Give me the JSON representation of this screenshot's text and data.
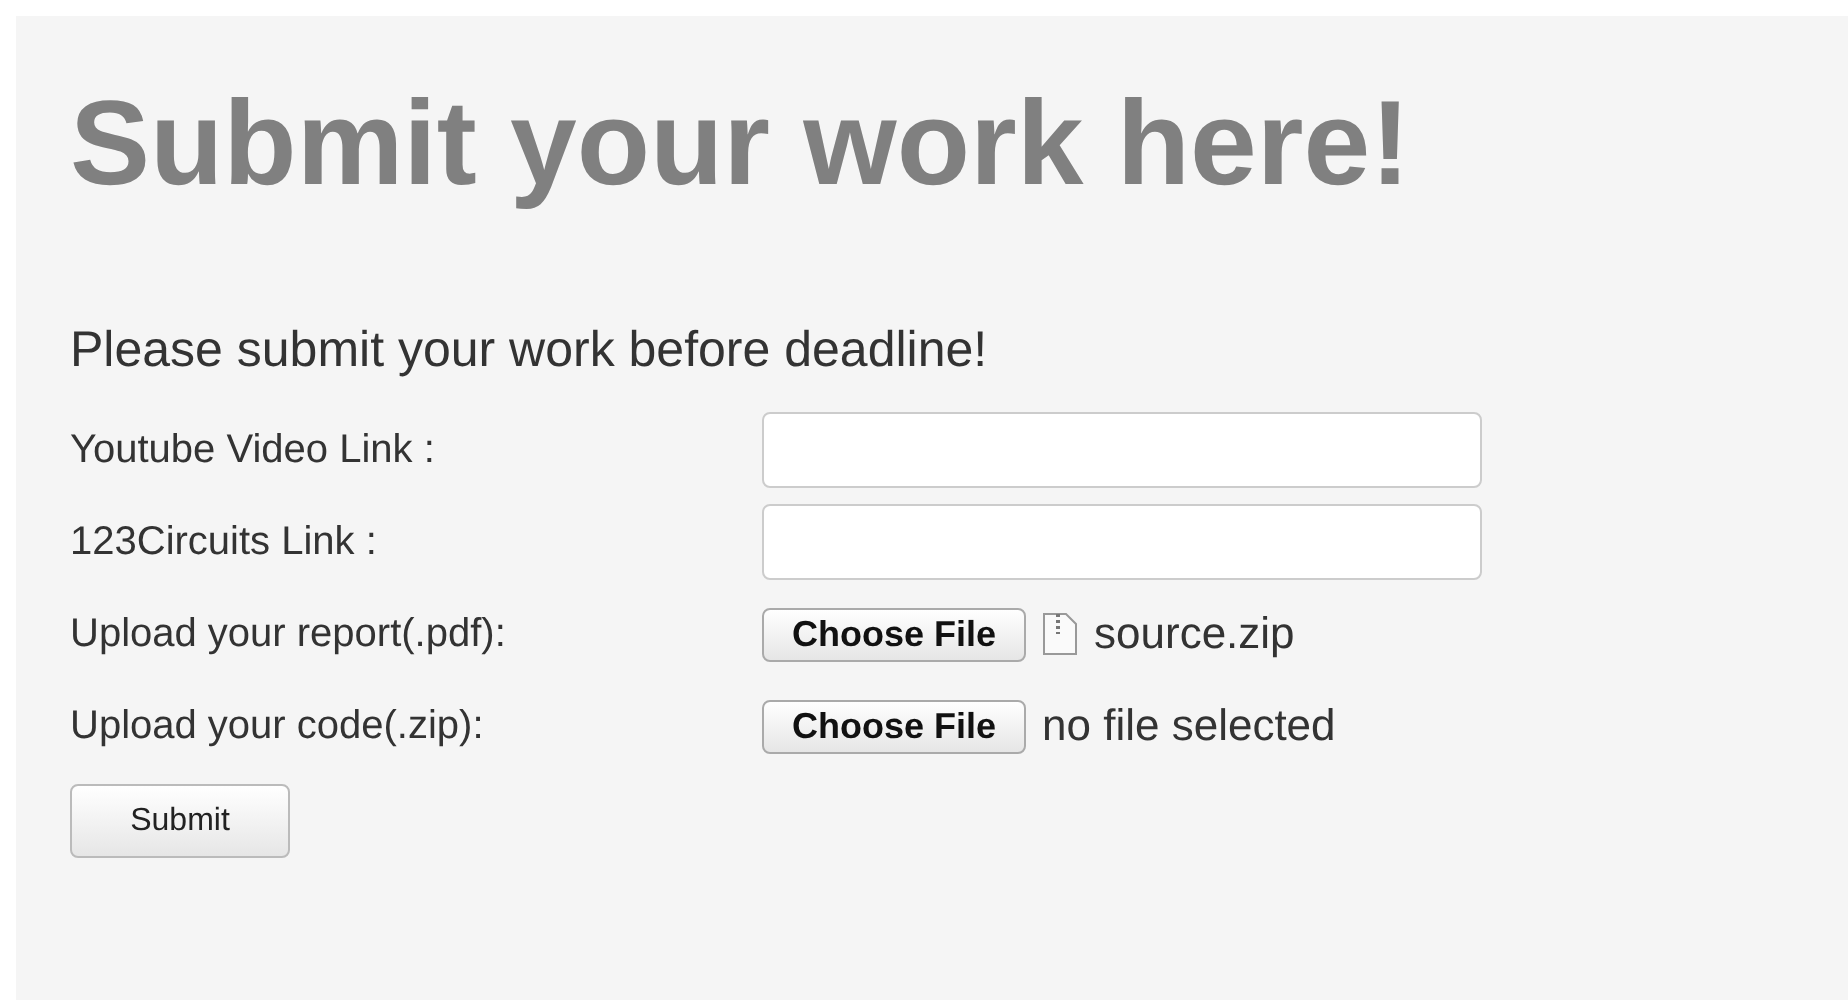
{
  "title": "Submit your work here!",
  "subtitle": "Please submit your work before deadline!",
  "fields": [
    {
      "kind": "text",
      "label": "Youtube Video Link :"
    },
    {
      "kind": "text",
      "label": "123Circuits Link :"
    },
    {
      "kind": "file",
      "label": "Upload your report(.pdf):",
      "button": "Choose File",
      "file_name": "source.zip",
      "has_file": true
    },
    {
      "kind": "file",
      "label": "Upload your code(.zip):",
      "button": "Choose File",
      "file_name": "no file selected",
      "has_file": false
    }
  ],
  "submit": "Submit"
}
